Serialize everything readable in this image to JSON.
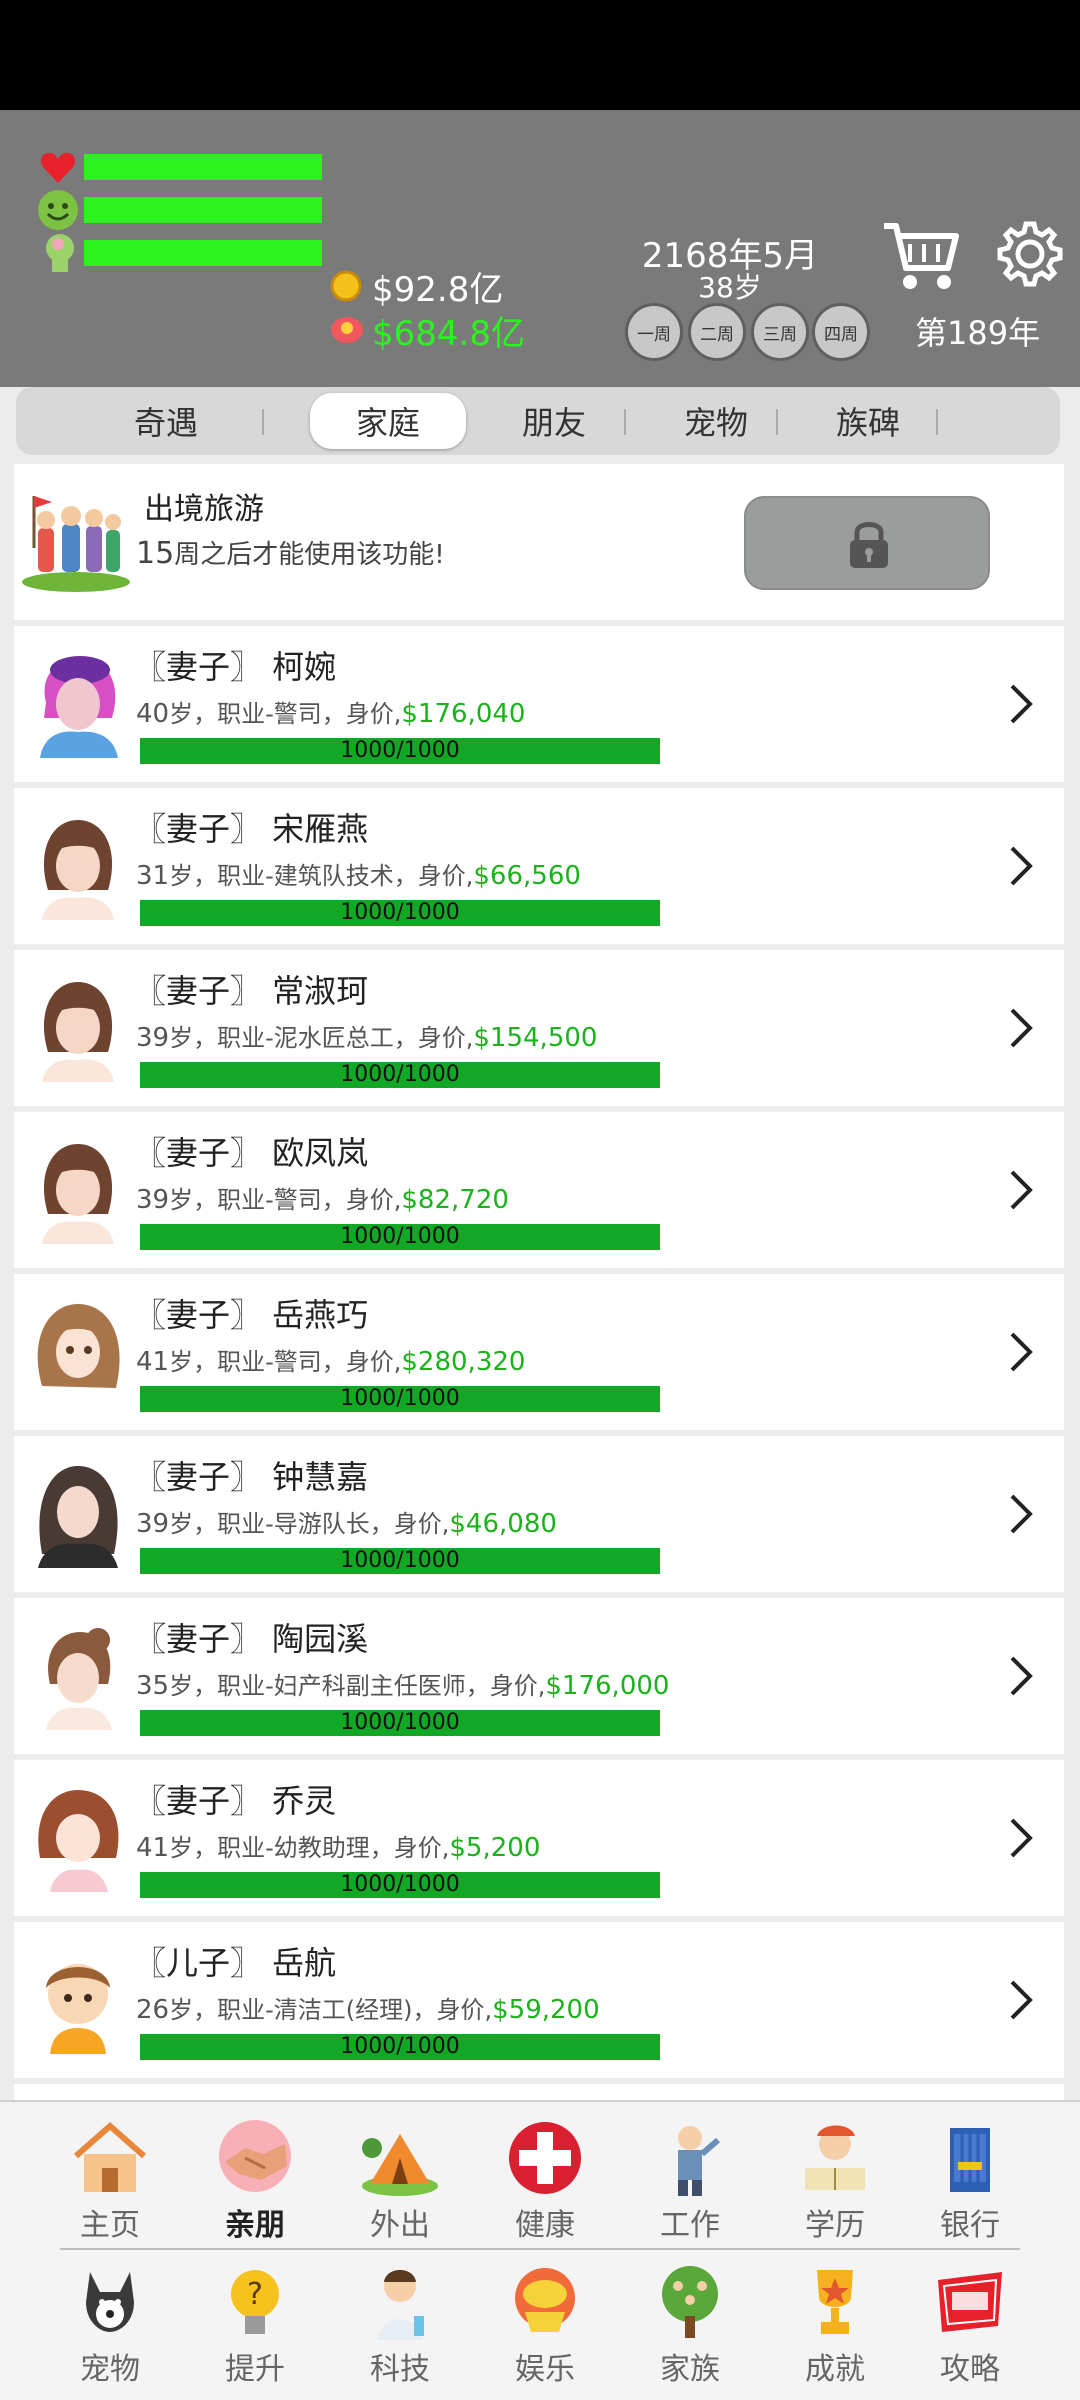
{
  "header": {
    "wealth": "$92.8亿",
    "assets": "$684.8亿",
    "date": "2168年5月",
    "age": "38岁",
    "weeks": [
      "一周",
      "二周",
      "三周",
      "四周"
    ],
    "year_count": "第189年",
    "stat_colors": {
      "health": "#2cf31e",
      "happiness": "#2cf31e",
      "intellect": "#2cf31e"
    }
  },
  "tabs": [
    "奇遇",
    "家庭",
    "朋友",
    "宠物",
    "族碑"
  ],
  "active_tab": "家庭",
  "travel": {
    "title": "出境旅游",
    "weeks_num": "15",
    "subtitle": "周之后才能使用该功能!"
  },
  "members": [
    {
      "title": "〖妻子〗 柯婉",
      "age": "40",
      "desc": "岁，职业-警司，身价,",
      "worth": "$176,040",
      "hp": "1000/1000"
    },
    {
      "title": "〖妻子〗 宋雁燕",
      "age": "31",
      "desc": "岁，职业-建筑队技术，身价,",
      "worth": "$66,560",
      "hp": "1000/1000"
    },
    {
      "title": "〖妻子〗 常淑珂",
      "age": "39",
      "desc": "岁，职业-泥水匠总工，身价,",
      "worth": "$154,500",
      "hp": "1000/1000"
    },
    {
      "title": "〖妻子〗 欧凤岚",
      "age": "39",
      "desc": "岁，职业-警司，身价,",
      "worth": "$82,720",
      "hp": "1000/1000"
    },
    {
      "title": "〖妻子〗 岳燕巧",
      "age": "41",
      "desc": "岁，职业-警司，身价,",
      "worth": "$280,320",
      "hp": "1000/1000"
    },
    {
      "title": "〖妻子〗 钟慧嘉",
      "age": "39",
      "desc": "岁，职业-导游队长，身价,",
      "worth": "$46,080",
      "hp": "1000/1000"
    },
    {
      "title": "〖妻子〗 陶园溪",
      "age": "35",
      "desc": "岁，职业-妇产科副主任医师，身价,",
      "worth": "$176,000",
      "hp": "1000/1000"
    },
    {
      "title": "〖妻子〗 乔灵",
      "age": "41",
      "desc": "岁，职业-幼教助理，身价,",
      "worth": "$5,200",
      "hp": "1000/1000"
    },
    {
      "title": "〖儿子〗 岳航",
      "age": "26",
      "desc": "岁，职业-清洁工(经理)，身价,",
      "worth": "$59,200",
      "hp": "1000/1000"
    }
  ],
  "nav_row1": [
    "主页",
    "亲朋",
    "外出",
    "健康",
    "工作",
    "学历",
    "银行"
  ],
  "nav_row2": [
    "宠物",
    "提升",
    "科技",
    "娱乐",
    "家族",
    "成就",
    "攻略"
  ],
  "nav_active": "亲朋",
  "nav_icons_row1": [
    "home-icon",
    "handshake-icon",
    "tent-icon",
    "medical-cross-icon",
    "worker-icon",
    "study-icon",
    "bank-icon"
  ],
  "nav_icons_row2": [
    "dog-icon",
    "lightbulb-icon",
    "scientist-icon",
    "gold-ingot-icon",
    "family-tree-icon",
    "trophy-icon",
    "tips-icon"
  ]
}
